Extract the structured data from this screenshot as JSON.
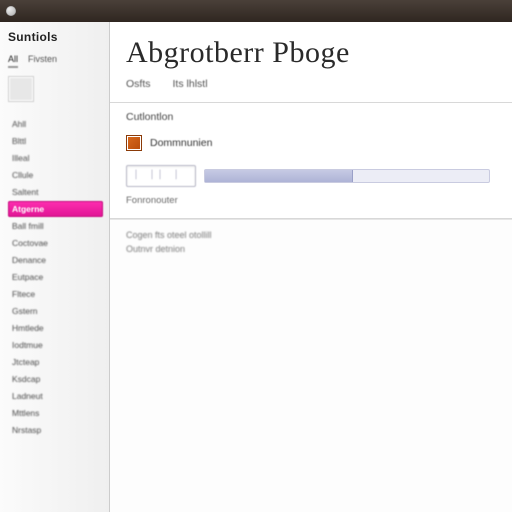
{
  "window": {
    "title": "Abgrotberr Pboge"
  },
  "sidebar": {
    "heading": "Suntiols",
    "tabs": [
      "All",
      "Fivsten"
    ],
    "block_label": "",
    "items": [
      "Ahll",
      "Blttl",
      "Illeal",
      "Cllule",
      "Saltent",
      "Atgerne",
      "Ball fmill",
      "Coctovae",
      "Denance",
      "Eutpace",
      "Fltece",
      "Gstern",
      "Hmtlede",
      "Iodtmue",
      "Jtcteap",
      "Ksdcap",
      "Ladneut",
      "Mttlens",
      "Nrstasp"
    ],
    "selected_index": 5
  },
  "toolbar": {
    "items": [
      "Osfts",
      "Its lhlstl"
    ]
  },
  "form": {
    "section_label": "Cutlontlon",
    "color_row_label": "Dommnunien",
    "field_value": "| || |",
    "caption": "Fonronouter"
  },
  "content": {
    "lines": [
      "Cogen fts oteel otollill",
      "Outnvr detnion"
    ]
  }
}
